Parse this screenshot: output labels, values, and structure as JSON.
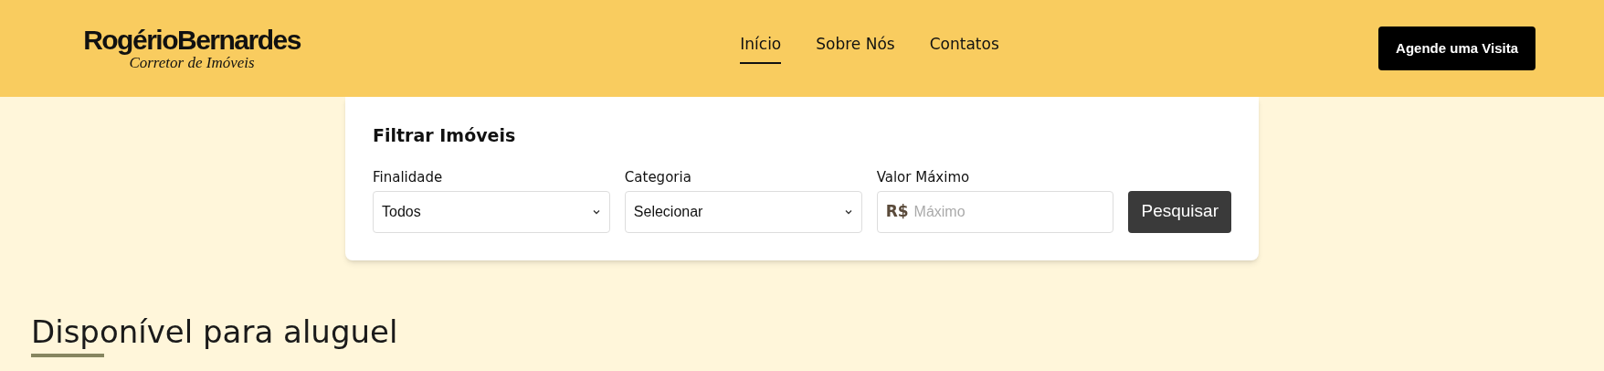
{
  "header": {
    "logo": {
      "name": "RogérioBernardes",
      "tagline": "Corretor de Imóveis"
    },
    "nav": [
      {
        "label": "Início",
        "selected": true
      },
      {
        "label": "Sobre Nós",
        "selected": false
      },
      {
        "label": "Contatos",
        "selected": false
      }
    ],
    "cta": "Agende uma Visita"
  },
  "filter": {
    "title": "Filtrar Imóveis",
    "fields": [
      {
        "kind": "select",
        "label": "Finalidade",
        "value": "Todos"
      },
      {
        "kind": "select",
        "label": "Categoria",
        "value": "Selecionar"
      },
      {
        "kind": "currency",
        "label": "Valor Máximo",
        "prefix": "R$",
        "placeholder": "Máximo"
      }
    ],
    "button": "Pesquisar"
  },
  "section": {
    "title": "Disponível para aluguel"
  }
}
